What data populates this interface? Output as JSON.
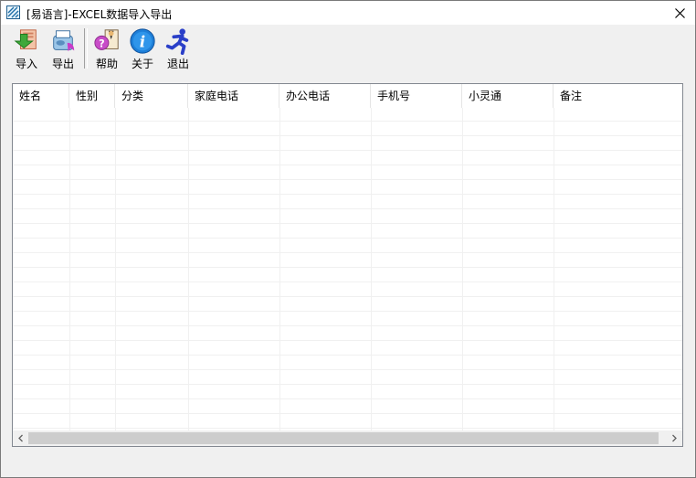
{
  "window": {
    "title": "[易语言]-EXCEL数据导入导出"
  },
  "toolbar": {
    "buttons": [
      {
        "label": "导入",
        "icon": "import-icon"
      },
      {
        "label": "导出",
        "icon": "export-icon"
      },
      {
        "label": "帮助",
        "icon": "help-icon"
      },
      {
        "label": "关于",
        "icon": "about-info-icon"
      },
      {
        "label": "退出",
        "icon": "exit-runner-icon"
      }
    ]
  },
  "table": {
    "columns": [
      "姓名",
      "性别",
      "分类",
      "家庭电话",
      "办公电话",
      "手机号",
      "小灵通",
      "备注"
    ],
    "rows": []
  },
  "colors": {
    "title_bg": "#ffffff",
    "window_bg": "#f0f0f0",
    "list_border": "#828790",
    "scroll_thumb": "#cdcdcd"
  }
}
